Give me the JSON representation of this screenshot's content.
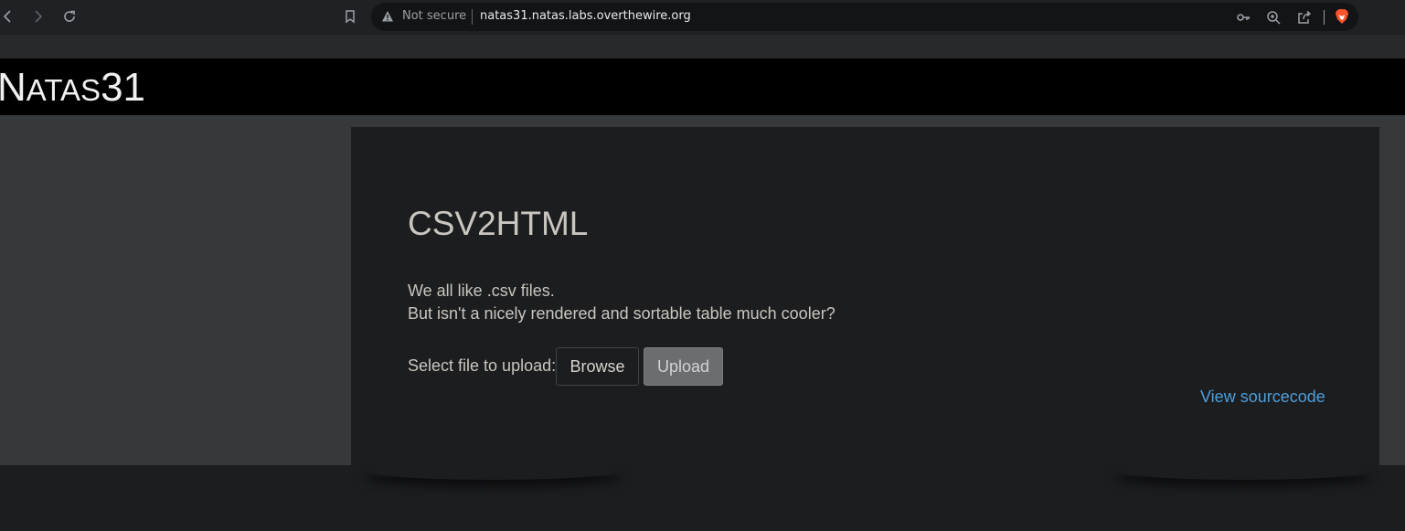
{
  "browser": {
    "security_label": "Not secure",
    "url": "natas31.natas.labs.overthewire.org",
    "icons": [
      "back-icon",
      "forward-icon",
      "reload-icon",
      "bookmark-icon",
      "warning-icon",
      "key-icon",
      "zoom-icon",
      "share-icon",
      "brave-icon"
    ]
  },
  "site": {
    "title_prefix": "N",
    "title_caps": "ATAS",
    "title_number": "31"
  },
  "main": {
    "heading": "CSV2HTML",
    "line1": "We all like .csv files.",
    "line2": "But isn't a nicely rendered and sortable table much cooler?",
    "upload_label": "Select file to upload:",
    "browse_label": "Browse",
    "upload_button": "Upload",
    "source_link": "View sourcecode"
  },
  "colors": {
    "header_bg": "#000000",
    "page_bg": "#35393b",
    "content_bg": "#1c1d1f",
    "link": "#4c9fdc",
    "upload_btn": "#6b6d6f"
  }
}
